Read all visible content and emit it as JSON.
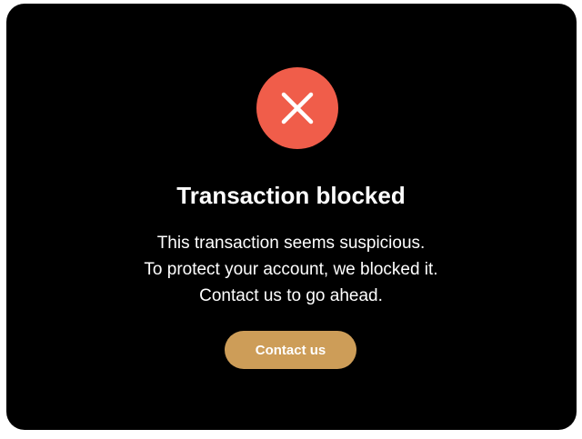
{
  "dialog": {
    "icon": "close-x-icon",
    "title": "Transaction blocked",
    "message_lines": [
      "This transaction seems suspicious.",
      "To protect your account, we blocked it.",
      "Contact us to go ahead."
    ],
    "button_label": "Contact us"
  },
  "colors": {
    "background": "#000000",
    "icon_circle": "#f05d4a",
    "icon_glyph": "#ffffff",
    "button": "#cd9d58",
    "text": "#ffffff"
  }
}
